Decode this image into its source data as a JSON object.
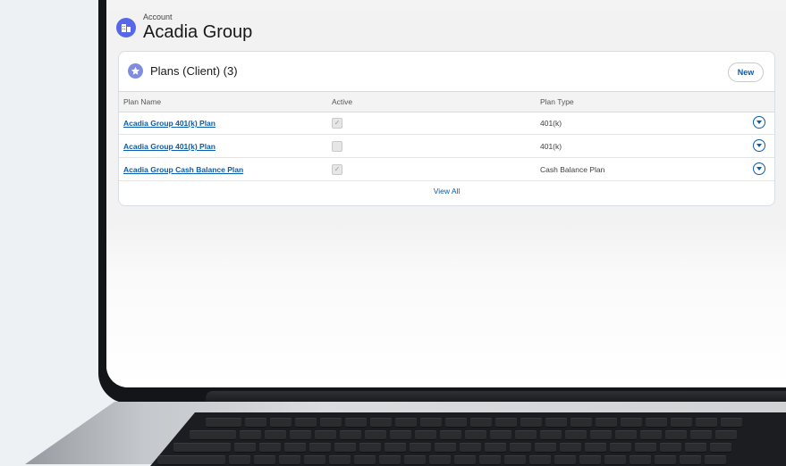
{
  "header": {
    "object_label": "Account",
    "record_name": "Acadia Group",
    "icon": "account-icon"
  },
  "plans_card": {
    "title": "Plans (Client) (3)",
    "icon": "star-icon",
    "new_label": "New",
    "columns": [
      "Plan Name",
      "Active",
      "Plan Type"
    ],
    "rows": [
      {
        "name": "Acadia Group 401(k) Plan",
        "active": true,
        "type": "401(k)"
      },
      {
        "name": "Acadia Group 401(k) Plan",
        "active": false,
        "type": "401(k)"
      },
      {
        "name": "Acadia Group Cash Balance Plan",
        "active": true,
        "type": "Cash Balance Plan"
      }
    ],
    "view_all_label": "View All"
  },
  "colors": {
    "accent": "#0b5cab",
    "account_icon": "#5867e8",
    "card_icon": "#7f8de1"
  }
}
